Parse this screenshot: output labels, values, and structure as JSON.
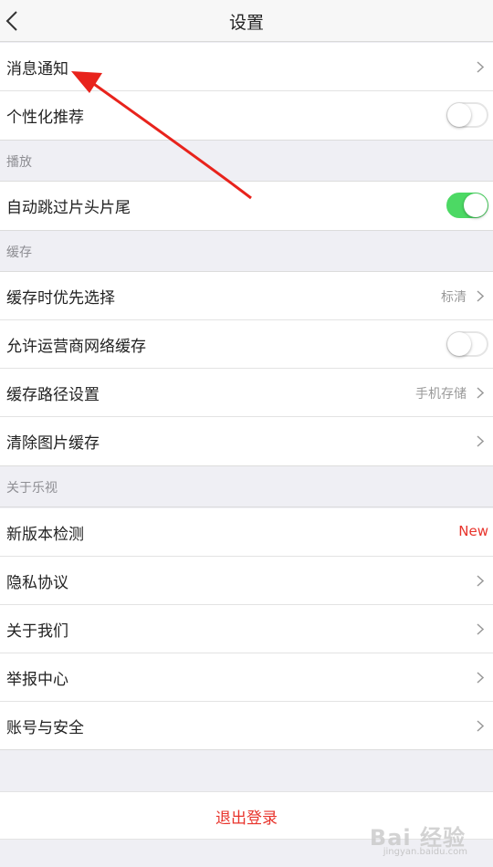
{
  "header": {
    "title": "设置"
  },
  "rows": {
    "message_notification": "消息通知",
    "personalized_recommendation": "个性化推荐",
    "auto_skip": "自动跳过片头片尾",
    "cache_priority": "缓存时优先选择",
    "cache_priority_value": "标清",
    "carrier_network_cache": "允许运营商网络缓存",
    "cache_path": "缓存路径设置",
    "cache_path_value": "手机存储",
    "clear_image_cache": "清除图片缓存",
    "version_check": "新版本检测",
    "version_check_badge": "New",
    "privacy": "隐私协议",
    "about_us": "关于我们",
    "report_center": "举报中心",
    "account_security": "账号与安全"
  },
  "sections": {
    "playback": "播放",
    "cache": "缓存",
    "about": "关于乐视"
  },
  "toggles": {
    "personalized_recommendation": false,
    "auto_skip": true,
    "carrier_network_cache": false
  },
  "logout": {
    "label": "退出登录"
  },
  "watermark": {
    "text": "Bai 经验",
    "subtext": "jingyan.baidu.com"
  },
  "colors": {
    "accent_red": "#e8342c",
    "toggle_on": "#4cd964",
    "annotation_arrow": "#e8231c"
  },
  "icons": {
    "back": "chevron-left-icon",
    "row_arrow": "chevron-right-icon"
  }
}
